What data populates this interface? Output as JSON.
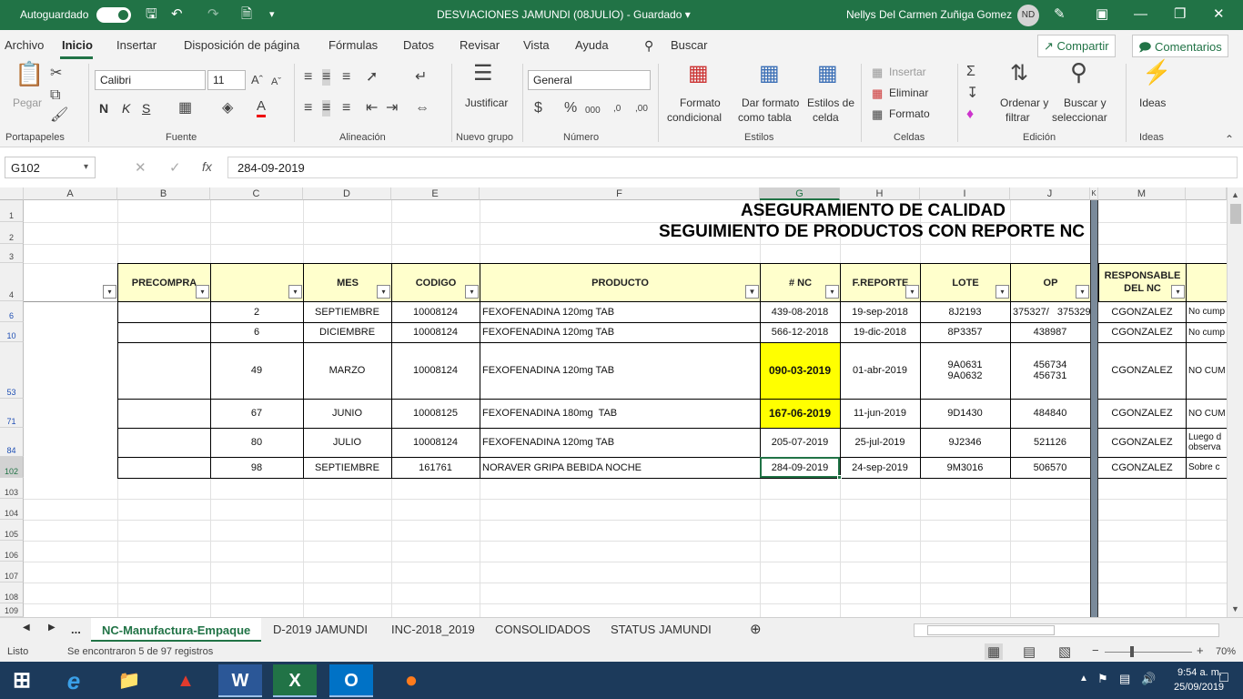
{
  "titlebar": {
    "autosave": "Autoguardado",
    "doc": "DESVIACIONES JAMUNDI (08JULIO)  -  Guardado ▾",
    "user": "Nellys Del Carmen Zuñiga Gomez",
    "initials": "ND"
  },
  "menu": {
    "items": [
      "Archivo",
      "Inicio",
      "Insertar",
      "Disposición de página",
      "Fórmulas",
      "Datos",
      "Revisar",
      "Vista",
      "Ayuda"
    ],
    "search": "Buscar",
    "share": "Compartir",
    "comments": "Comentarios"
  },
  "ribbon": {
    "paste": "Pegar",
    "font": "Calibri",
    "size": "11",
    "bold": "N",
    "italic": "K",
    "underline": "S",
    "justify": "Justificar",
    "number_format": "General",
    "cond_format": [
      "Formato",
      "condicional"
    ],
    "table_format": [
      "Dar formato",
      "como tabla"
    ],
    "cell_styles": [
      "Estilos de",
      "celda"
    ],
    "insert": "Insertar",
    "delete": "Eliminar",
    "format": "Formato",
    "sort": [
      "Ordenar y",
      "filtrar"
    ],
    "find": [
      "Buscar y",
      "seleccionar"
    ],
    "ideas": "Ideas",
    "groups": [
      "Portapapeles",
      "Fuente",
      "Alineación",
      "Nuevo grupo",
      "Número",
      "Estilos",
      "Celdas",
      "Edición",
      "Ideas"
    ]
  },
  "formula": {
    "namebox": "G102",
    "value": "284-09-2019"
  },
  "sheet": {
    "columns": [
      "A",
      "B",
      "C",
      "D",
      "E",
      "F",
      "G",
      "H",
      "I",
      "J",
      "K",
      "M"
    ],
    "title1": "ASEGURAMIENTO DE CALIDAD",
    "title2": "SEGUIMIENTO DE PRODUCTOS CON REPORTE NC",
    "headers": {
      "b": "PRECOMPRA",
      "d": "MES",
      "e": "CODIGO",
      "f": "PRODUCTO",
      "g": "# NC",
      "h": "F.REPORTE",
      "i": "LOTE",
      "j": "OP",
      "m1": "RESPONSABLE",
      "m2": "DEL NC"
    },
    "rownums": [
      "1",
      "2",
      "3",
      "4",
      "6",
      "10",
      "53",
      "71",
      "84",
      "102",
      "103",
      "104",
      "105",
      "106",
      "107",
      "108",
      "109"
    ],
    "rows": [
      {
        "c": "2",
        "d": "SEPTIEMBRE",
        "e": "10008124",
        "f": "FEXOFENADINA 120mg TAB",
        "g": "439-08-2018",
        "h": "19-sep-2018",
        "i": "8J2193",
        "j": "375327/   375329",
        "m": "CGONZALEZ",
        "n": "No cump"
      },
      {
        "c": "6",
        "d": "DICIEMBRE",
        "e": "10008124",
        "f": "FEXOFENADINA 120mg TAB",
        "g": "566-12-2018",
        "h": "19-dic-2018",
        "i": "8P3357",
        "j": "438987",
        "m": "CGONZALEZ",
        "n": "No cump"
      },
      {
        "c": "49",
        "d": "MARZO",
        "e": "10008124",
        "f": "FEXOFENADINA 120mg TAB",
        "g": "090-03-2019",
        "h": "01-abr-2019",
        "i": "9A0631",
        "i2": "9A0632",
        "j": "456734",
        "j2": "456731",
        "m": "CGONZALEZ",
        "n": "NO CUM"
      },
      {
        "c": "67",
        "d": "JUNIO",
        "e": "10008125",
        "f": "FEXOFENADINA 180mg  TAB",
        "g": "167-06-2019",
        "h": "11-jun-2019",
        "i": "9D1430",
        "j": "484840",
        "m": "CGONZALEZ",
        "n": "NO CUM"
      },
      {
        "c": "80",
        "d": "JULIO",
        "e": "10008124",
        "f": "FEXOFENADINA 120mg TAB",
        "g": "205-07-2019",
        "h": "25-jul-2019",
        "i": "9J2346",
        "j": "521126",
        "m": "CGONZALEZ",
        "n": "Luego d",
        "n2": "observa"
      },
      {
        "c": "98",
        "d": "SEPTIEMBRE",
        "e": "161761",
        "f": "NORAVER GRIPA BEBIDA NOCHE",
        "g": "284-09-2019",
        "h": "24-sep-2019",
        "i": "9M3016",
        "j": "506570",
        "m": "CGONZALEZ",
        "n": "Sobre c"
      }
    ]
  },
  "tabs": [
    "...",
    "NC-Manufactura-Empaque",
    "D-2019 JAMUNDI",
    "INC-2018_2019",
    "CONSOLIDADOS",
    "STATUS JAMUNDI"
  ],
  "status": {
    "ready": "Listo",
    "found": "Se encontraron 5 de 97 registros",
    "zoom": "70%"
  },
  "taskbar": {
    "time": "9:54 a. m.",
    "date": "25/09/2019"
  },
  "colors": {
    "excel_green": "#217346",
    "header_fill": "#ffffcc",
    "highlight": "#ffff00"
  }
}
